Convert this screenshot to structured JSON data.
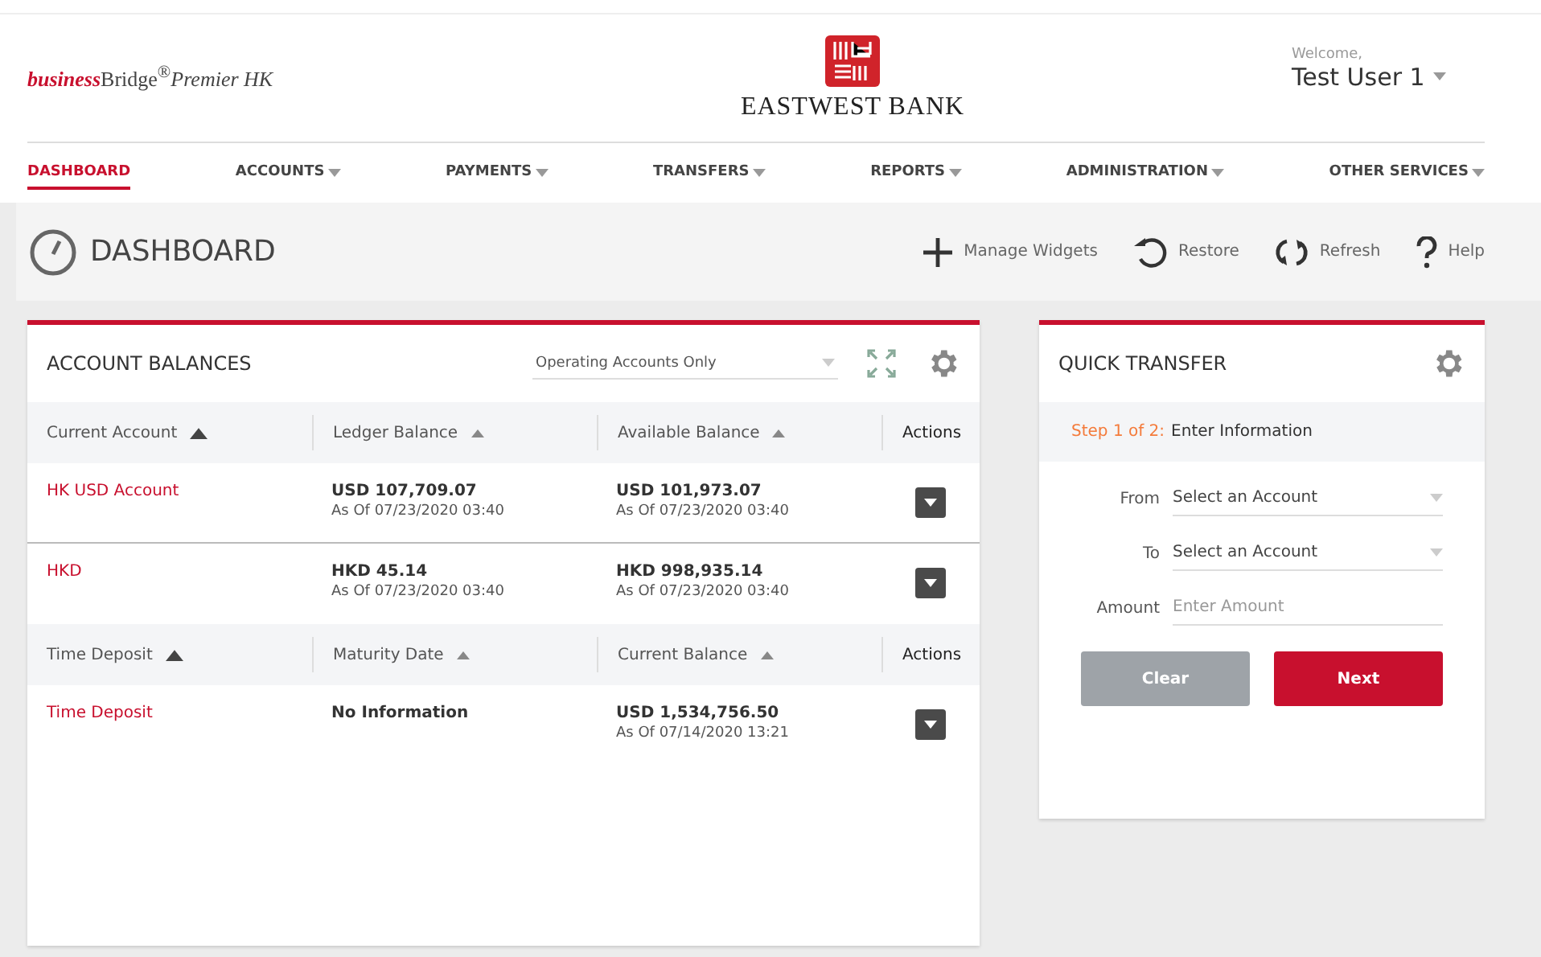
{
  "brand": {
    "product": "**business**Bridge$^{®}$*Premier HK*",
    "bank": "EASTWEST BANK"
  },
  "user": {
    "greeting": "Welcome,",
    "name": "Test User 1"
  },
  "nav": [
    {
      "label": "DASHBOARD",
      "selected": true,
      "menu": false
    },
    {
      "label": "ACCOUNTS",
      "selected": false,
      "menu": true
    },
    {
      "label": "PAYMENTS",
      "selected": false,
      "menu": true
    },
    {
      "label": "TRANSFERS",
      "selected": false,
      "menu": true
    },
    {
      "label": "REPORTS",
      "selected": false,
      "menu": true
    },
    {
      "label": "ADMINISTRATION",
      "selected": false,
      "menu": true
    },
    {
      "label": "OTHER SERVICES",
      "selected": false,
      "menu": true
    }
  ],
  "page_title": "DASHBOARD",
  "toolbar": [
    {
      "kind": "plus",
      "label": "Manage Widgets"
    },
    {
      "kind": "restore",
      "label": "Restore"
    },
    {
      "kind": "refresh",
      "label": "Refresh"
    },
    {
      "kind": "help",
      "label": "Help"
    }
  ],
  "balances": {
    "title": "ACCOUNT BALANCES",
    "filter": "Operating Accounts Only",
    "sections": [
      {
        "columns": [
          {
            "label": "Current Account",
            "sorted": true
          },
          {
            "label": "Ledger Balance",
            "sorted": false
          },
          {
            "label": "Available Balance",
            "sorted": false
          }
        ],
        "actions_label": "Actions",
        "rows": [
          {
            "name": "HK USD Account",
            "col2": {
              "amount": "USD 107,709.07",
              "as_of": "As Of 07/23/2020 03:40"
            },
            "col3": {
              "amount": "USD 101,973.07",
              "as_of": "As Of 07/23/2020 03:40"
            }
          },
          {
            "name": "HKD",
            "col2": {
              "amount": "HKD 45.14",
              "as_of": "As Of 07/23/2020 03:40"
            },
            "col3": {
              "amount": "HKD 998,935.14",
              "as_of": "As Of 07/23/2020 03:40"
            }
          }
        ]
      },
      {
        "columns": [
          {
            "label": "Time Deposit",
            "sorted": true
          },
          {
            "label": "Maturity Date",
            "sorted": false
          },
          {
            "label": "Current Balance",
            "sorted": false
          }
        ],
        "actions_label": "Actions",
        "rows": [
          {
            "name": "Time Deposit",
            "col2": {
              "amount": "No Information"
            },
            "col3": {
              "amount": "USD 1,534,756.50",
              "as_of": "As Of 07/14/2020 13:21"
            }
          }
        ]
      }
    ]
  },
  "quick_transfer": {
    "title": "QUICK TRANSFER",
    "step": "Step 1 of 2:",
    "step_label": "Enter Information",
    "fields": [
      {
        "kind": "select",
        "label": "From",
        "placeholder": "Select an Account"
      },
      {
        "kind": "select",
        "label": "To",
        "placeholder": "Select an Account"
      },
      {
        "kind": "input",
        "label": "Amount",
        "placeholder": "Enter Amount"
      }
    ],
    "buttons": [
      {
        "label": "Clear",
        "kind": "secondary"
      },
      {
        "label": "Next",
        "kind": "primary"
      }
    ]
  }
}
